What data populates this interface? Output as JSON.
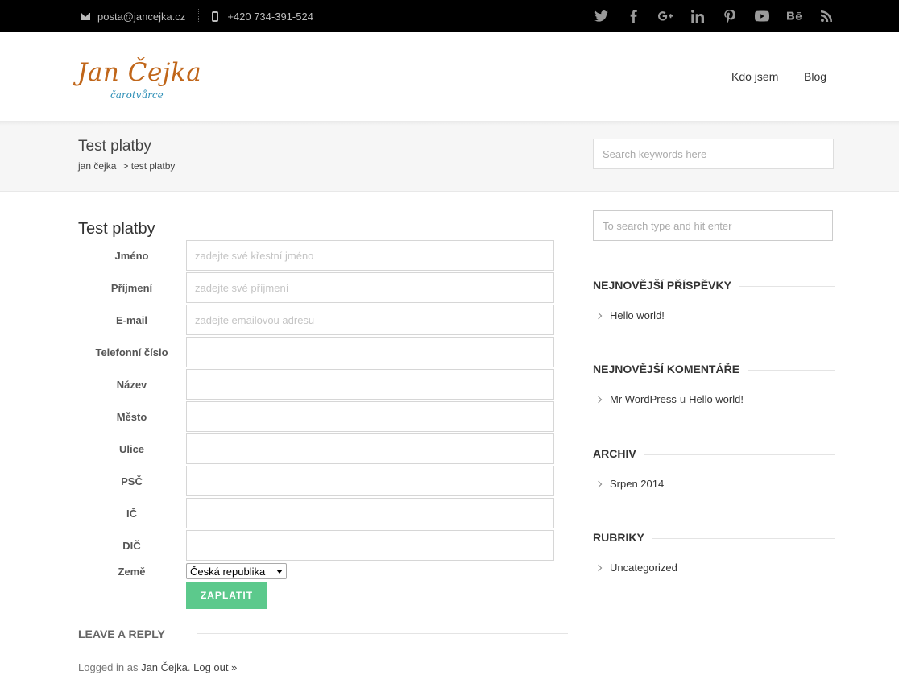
{
  "topbar": {
    "email": "posta@jancejka.cz",
    "phone": "+420 734-391-524",
    "socials": [
      "twitter-icon",
      "facebook-icon",
      "google-plus-icon",
      "linkedin-icon",
      "pinterest-icon",
      "youtube-icon",
      "behance-icon",
      "rss-icon"
    ]
  },
  "header": {
    "logo_name": "Jan Čejka",
    "logo_sub": "čarotvůrce",
    "nav": [
      "Kdo jsem",
      "Blog"
    ]
  },
  "titlebar": {
    "title": "Test platby",
    "breadcrumb": [
      "jan čejka",
      "> test platby"
    ],
    "search_placeholder": "Search keywords here"
  },
  "form": {
    "title": "Test platby",
    "fields": [
      {
        "label": "Jméno",
        "placeholder": "zadejte své křestní jméno"
      },
      {
        "label": "Příjmení",
        "placeholder": "zadejte své příjmení"
      },
      {
        "label": "E-mail",
        "placeholder": "zadejte emailovou adresu"
      },
      {
        "label": "Telefonní číslo",
        "placeholder": ""
      },
      {
        "label": "Název",
        "placeholder": ""
      },
      {
        "label": "Město",
        "placeholder": ""
      },
      {
        "label": "Ulice",
        "placeholder": ""
      },
      {
        "label": "PSČ",
        "placeholder": ""
      },
      {
        "label": "IČ",
        "placeholder": ""
      },
      {
        "label": "DIČ",
        "placeholder": ""
      }
    ],
    "country_label": "Země",
    "country_value": "Česká republika",
    "submit_label": "ZAPLATIT"
  },
  "reply": {
    "heading": "LEAVE A REPLY",
    "logged_prefix": "Logged in as",
    "user": "Jan Čejka",
    "logout": "Log out »"
  },
  "sidebar": {
    "search_placeholder": "To search type and hit enter",
    "widgets": {
      "recent_posts": {
        "title": "NEJNOVĚJŠÍ PŘÍSPĚVKY",
        "items": [
          "Hello world!"
        ]
      },
      "recent_comments": {
        "title": "NEJNOVĚJŠÍ KOMENTÁŘE",
        "author": "Mr WordPress",
        "connector": "u",
        "post": "Hello world!"
      },
      "archive": {
        "title": "ARCHIV",
        "items": [
          "Srpen 2014"
        ]
      },
      "categories": {
        "title": "RUBRIKY",
        "items": [
          "Uncategorized"
        ]
      }
    }
  },
  "colors": {
    "logo": "#c0661a",
    "logo_sub": "#2e8fb7",
    "button": "#5cc98c",
    "topbar": "#000000"
  }
}
